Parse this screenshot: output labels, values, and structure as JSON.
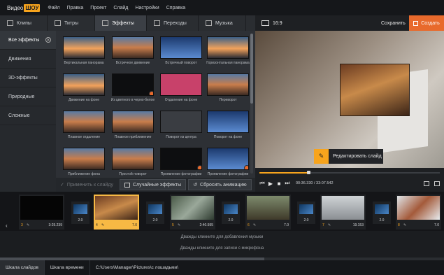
{
  "menubar": {
    "logo_left": "Видео",
    "logo_right": "ШОУ",
    "items": [
      "Файл",
      "Правка",
      "Проект",
      "Слайд",
      "Настройки",
      "Справка"
    ]
  },
  "tabs": [
    {
      "label": "Клипы",
      "icon": "film-icon"
    },
    {
      "label": "Титры",
      "icon": "text-icon"
    },
    {
      "label": "Эффекты",
      "icon": "wand-icon"
    },
    {
      "label": "Переходы",
      "icon": "transition-icon"
    },
    {
      "label": "Музыка",
      "icon": "music-icon"
    }
  ],
  "topright": {
    "ratio": "16:9",
    "save": "Сохранить",
    "create": "Создать"
  },
  "sidebar": {
    "items": [
      "Все эффекты",
      "Движения",
      "3D-эффекты",
      "Природные",
      "Сложные"
    ],
    "close_glyph": "✕"
  },
  "effects": [
    {
      "label": "Вертикальная панорама"
    },
    {
      "label": "Встречное движение"
    },
    {
      "label": "Встречный поворот"
    },
    {
      "label": "Горизонтальная панорама"
    },
    {
      "label": "Движение на фоне"
    },
    {
      "label": "Из цветного в черно-белое"
    },
    {
      "label": "Отдаление на фоне"
    },
    {
      "label": "Переворот"
    },
    {
      "label": "Плавное отдаление"
    },
    {
      "label": "Плавное приближение"
    },
    {
      "label": "Поворот из центра"
    },
    {
      "label": "Поворот на фоне"
    },
    {
      "label": "Приближение фона"
    },
    {
      "label": "Простой поворот"
    },
    {
      "label": "Проявление фотографии"
    },
    {
      "label": "Проявление фотографии"
    }
  ],
  "actions": {
    "apply": "Применить к слайду",
    "random": "Случайные эффекты",
    "reset": "Сбросить анимацию"
  },
  "preview": {
    "edit": "Редактировать слайд",
    "edit_glyph": "✎"
  },
  "player": {
    "time": "00:36.330 / 33:07.542",
    "progress": 0.27
  },
  "timeline": {
    "clips": [
      {
        "num": "3",
        "dur": "3:25.239"
      },
      {
        "num": "4",
        "dur": "7.0"
      },
      {
        "num": "5",
        "dur": "2:40.595"
      },
      {
        "num": "6",
        "dur": "7.0"
      },
      {
        "num": "7",
        "dur": "19.153"
      },
      {
        "num": "8",
        "dur": "7.0"
      }
    ],
    "transitions": [
      "2.0",
      "2.0",
      "2.0",
      "2.0",
      "2.0"
    ]
  },
  "audio": {
    "music_hint": "Дважды кликните для добавления музыки",
    "mic_hint": "Дважды кликните для записи с микрофона"
  },
  "statusbar": {
    "tabs": [
      "Шкала слайдов",
      "Шкала времени"
    ],
    "path": "C:\\Users\\Manager\\Pictures\\с лошадьми\\"
  },
  "colors": {
    "accent": "#f7a41d",
    "create": "#e86a2c"
  }
}
